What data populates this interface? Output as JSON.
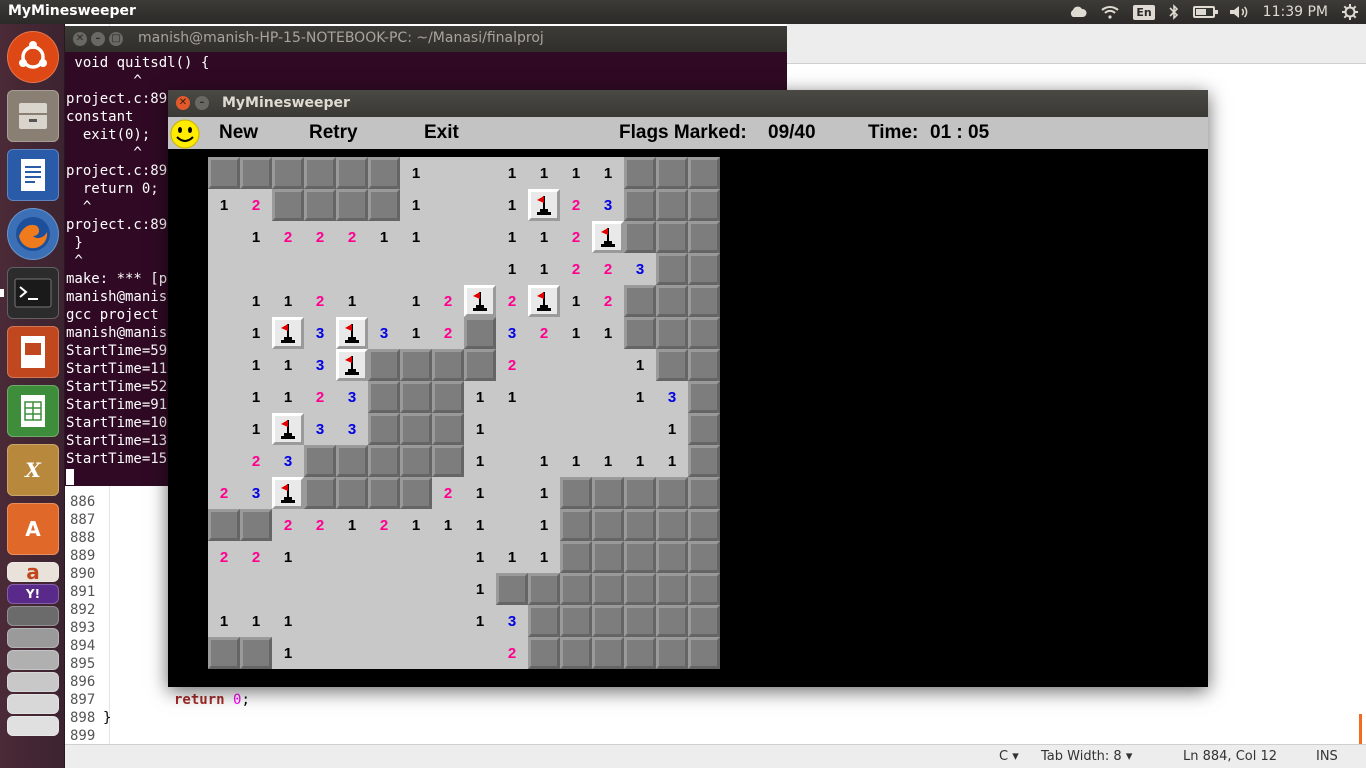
{
  "top_panel": {
    "app_title": "MyMinesweeper",
    "language": "En",
    "clock": "11:39 PM"
  },
  "launcher": {
    "items": [
      "ubuntu-dash",
      "files",
      "writer",
      "firefox",
      "terminal",
      "impress",
      "calc",
      "xfig",
      "software-center",
      "amazon",
      "yahoo-mail",
      "workspaces",
      "trash"
    ]
  },
  "terminal": {
    "title": "manish@manish-HP-15-NOTEBOOK-PC: ~/Manasi/finalproj",
    "lines": [
      " void quitsdl() {",
      "        ^",
      "project.c:89",
      "constant",
      "  exit(0);",
      "        ^",
      "project.c:89",
      "  return 0;",
      "  ^",
      "project.c:89",
      " }",
      " ^",
      "make: *** [p",
      "manish@manis",
      "gcc project",
      "manish@manis",
      "StartTime=59",
      "StartTime=11",
      "StartTime=52",
      "StartTime=91",
      "StartTime=10",
      "StartTime=13",
      "StartTime=15"
    ]
  },
  "editor": {
    "line_numbers": [
      "886",
      "887",
      "888",
      "889",
      "890",
      "891",
      "892",
      "893",
      "894",
      "895",
      "896",
      "897",
      "898",
      "899"
    ],
    "code_return": "return",
    "code_zero": "0",
    "code_semicolon": ";",
    "code_brace": "}",
    "status": {
      "language": "C",
      "tab_width": "Tab Width: 8",
      "position": "Ln 884, Col 12",
      "mode": "INS"
    }
  },
  "game": {
    "title": "MyMinesweeper",
    "menu": {
      "new": "New",
      "retry": "Retry",
      "exit": "Exit",
      "flags_label": "Flags Marked:",
      "flags_value": "09/40",
      "time_label": "Time:",
      "time_value": "01 : 05"
    },
    "grid_legend": {
      "C": "covered",
      "F": "flagged",
      ".": "open-empty",
      "1-8": "open-number"
    },
    "grid": [
      "CCCCCC1..1111CCC",
      "12CCCC1..1F23CCC",
      ".122211..112FCCC",
      ".........11223CCC",
      ".1121.12F2F12CCC",
      ".1F3F312C3211CCC",
      ".113FCCCC2...1CC",
      ".1123CCC11...13C",
      ".1F33CCC1.....1C",
      ".23CCCCC1.11111C",
      "23FCCCC21.1CCCCC",
      "CC2212111.1CCCCC",
      "221.....111CCCCC",
      "........1CCCCCCC",
      "111.....13CCCCCC",
      "CC1......2CCCCCC"
    ]
  }
}
